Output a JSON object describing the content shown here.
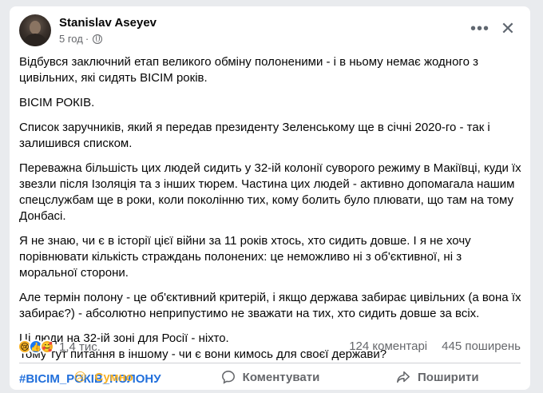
{
  "post": {
    "author": "Stanislav Aseyev",
    "time": "5 год",
    "time_sep": "·",
    "paragraphs": [
      "Відбувся заключний етап великого обміну полоненими - і в ньому немає жодного з цивільних, які сидять ВІСІМ років.",
      "ВІСІМ РОКІВ.",
      "Список заручників, який я передав президенту Зеленському ще в січні 2020-го - так і залишився списком.",
      "Переважна більшість цих людей сидить у 32-ій колонії суворого режиму в Макіївці, куди їх звезли після Ізоляція та з інших тюрем. Частина цих людей - активно допомагала нашим спецслужбам ще в роки, коли поколінню тих, кому болить було плювати, що там на тому Донбасі.",
      "Я не знаю, чи є в історії цієї війни за 11 років хтось, хто сидить довше. І я не хочу порівнювати кількість страждань полонених: це неможливо ні з об'єктивної, ні з моральної сторони.",
      "Але термін полону - це об'єктивний критерій, і якщо держава забирає цивільних (а вона їх забирає?) - абсолютно неприпустимо не зважати на тих, хто сидить довше за всіх.",
      "Ці люди на 32-ій зоні для Росії - ніхто.",
      "Тому тут питання в іншому - чи є вони кимось для своєї держави?"
    ],
    "hashtag": "#ВІСІМ_РОКІВ_ПОЛОНУ"
  },
  "reactions": {
    "count": "1,4 тис.",
    "comments": "124 коментарі",
    "shares": "445 поширень"
  },
  "actions": {
    "react": "Сумно",
    "comment": "Коментувати",
    "share": "Поширити"
  },
  "colors": {
    "hashtag": "#216fdb",
    "sad_reaction": "#f7b125",
    "like": "#1877f2"
  },
  "icons": {
    "more": "more-dots-icon",
    "close": "close-icon",
    "privacy": "globe-icon",
    "comment": "comment-bubble-icon",
    "share": "share-arrow-icon"
  }
}
